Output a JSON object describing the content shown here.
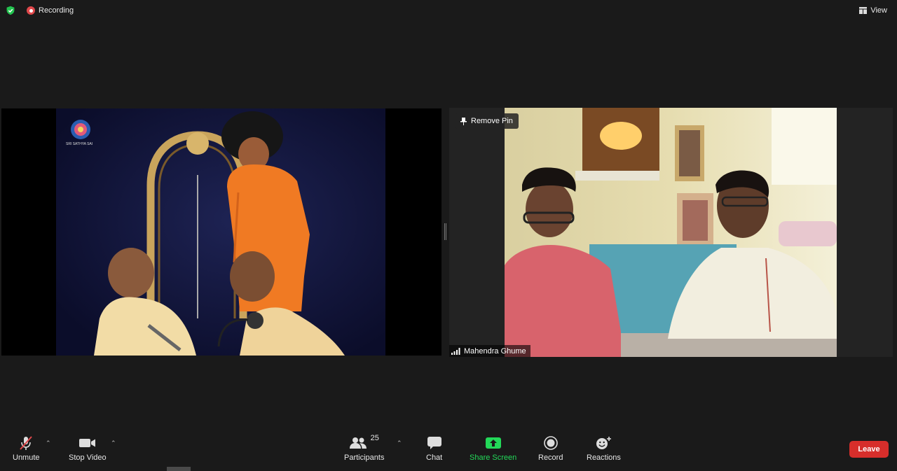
{
  "topbar": {
    "recording_label": "Recording",
    "view_label": "View"
  },
  "videos": {
    "left": {
      "logo_text": "SRI SATHYA SAI"
    },
    "right": {
      "pin_label": "Remove Pin",
      "participant_name": "Mahendra Ghume"
    }
  },
  "toolbar": {
    "unmute_label": "Unmute",
    "stop_video_label": "Stop Video",
    "participants_label": "Participants",
    "participants_count": "25",
    "chat_label": "Chat",
    "share_screen_label": "Share Screen",
    "record_label": "Record",
    "reactions_label": "Reactions",
    "leave_label": "Leave"
  },
  "colors": {
    "background": "#1a1a1a",
    "share_green": "#23d959",
    "leave_red": "#d72e2b",
    "record_red": "#e0484b",
    "shield_green": "#23c34f"
  }
}
